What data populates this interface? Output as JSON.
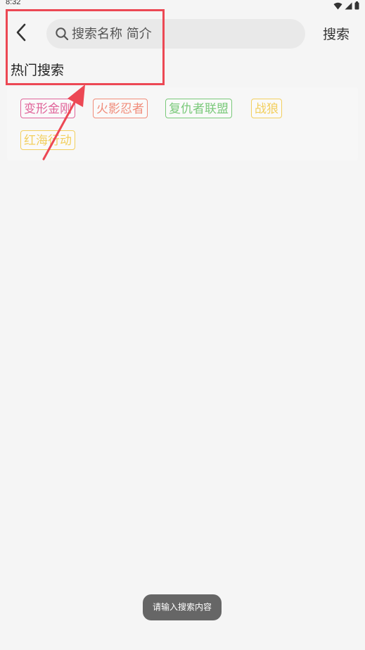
{
  "status_bar": {
    "time": "8:32",
    "icons": [
      "wifi-icon",
      "cellular-signal-icon",
      "battery-icon"
    ]
  },
  "header": {
    "back_icon": "chevron-left-icon",
    "search": {
      "icon": "search-icon",
      "placeholder": "搜索名称 简介",
      "value": ""
    },
    "search_button_label": "搜索"
  },
  "hot_search": {
    "title": "热门搜索",
    "tags": [
      {
        "label": "变形金刚",
        "color": "#e0649a"
      },
      {
        "label": "火影忍者",
        "color": "#f08c7a"
      },
      {
        "label": "复仇者联盟",
        "color": "#7ac97a"
      },
      {
        "label": "战狼",
        "color": "#f2cf5e"
      },
      {
        "label": "红海行动",
        "color": "#f2cf5e"
      }
    ]
  },
  "annotation": {
    "color": "#ec4854"
  },
  "toast": {
    "text": "请输入搜索内容"
  }
}
